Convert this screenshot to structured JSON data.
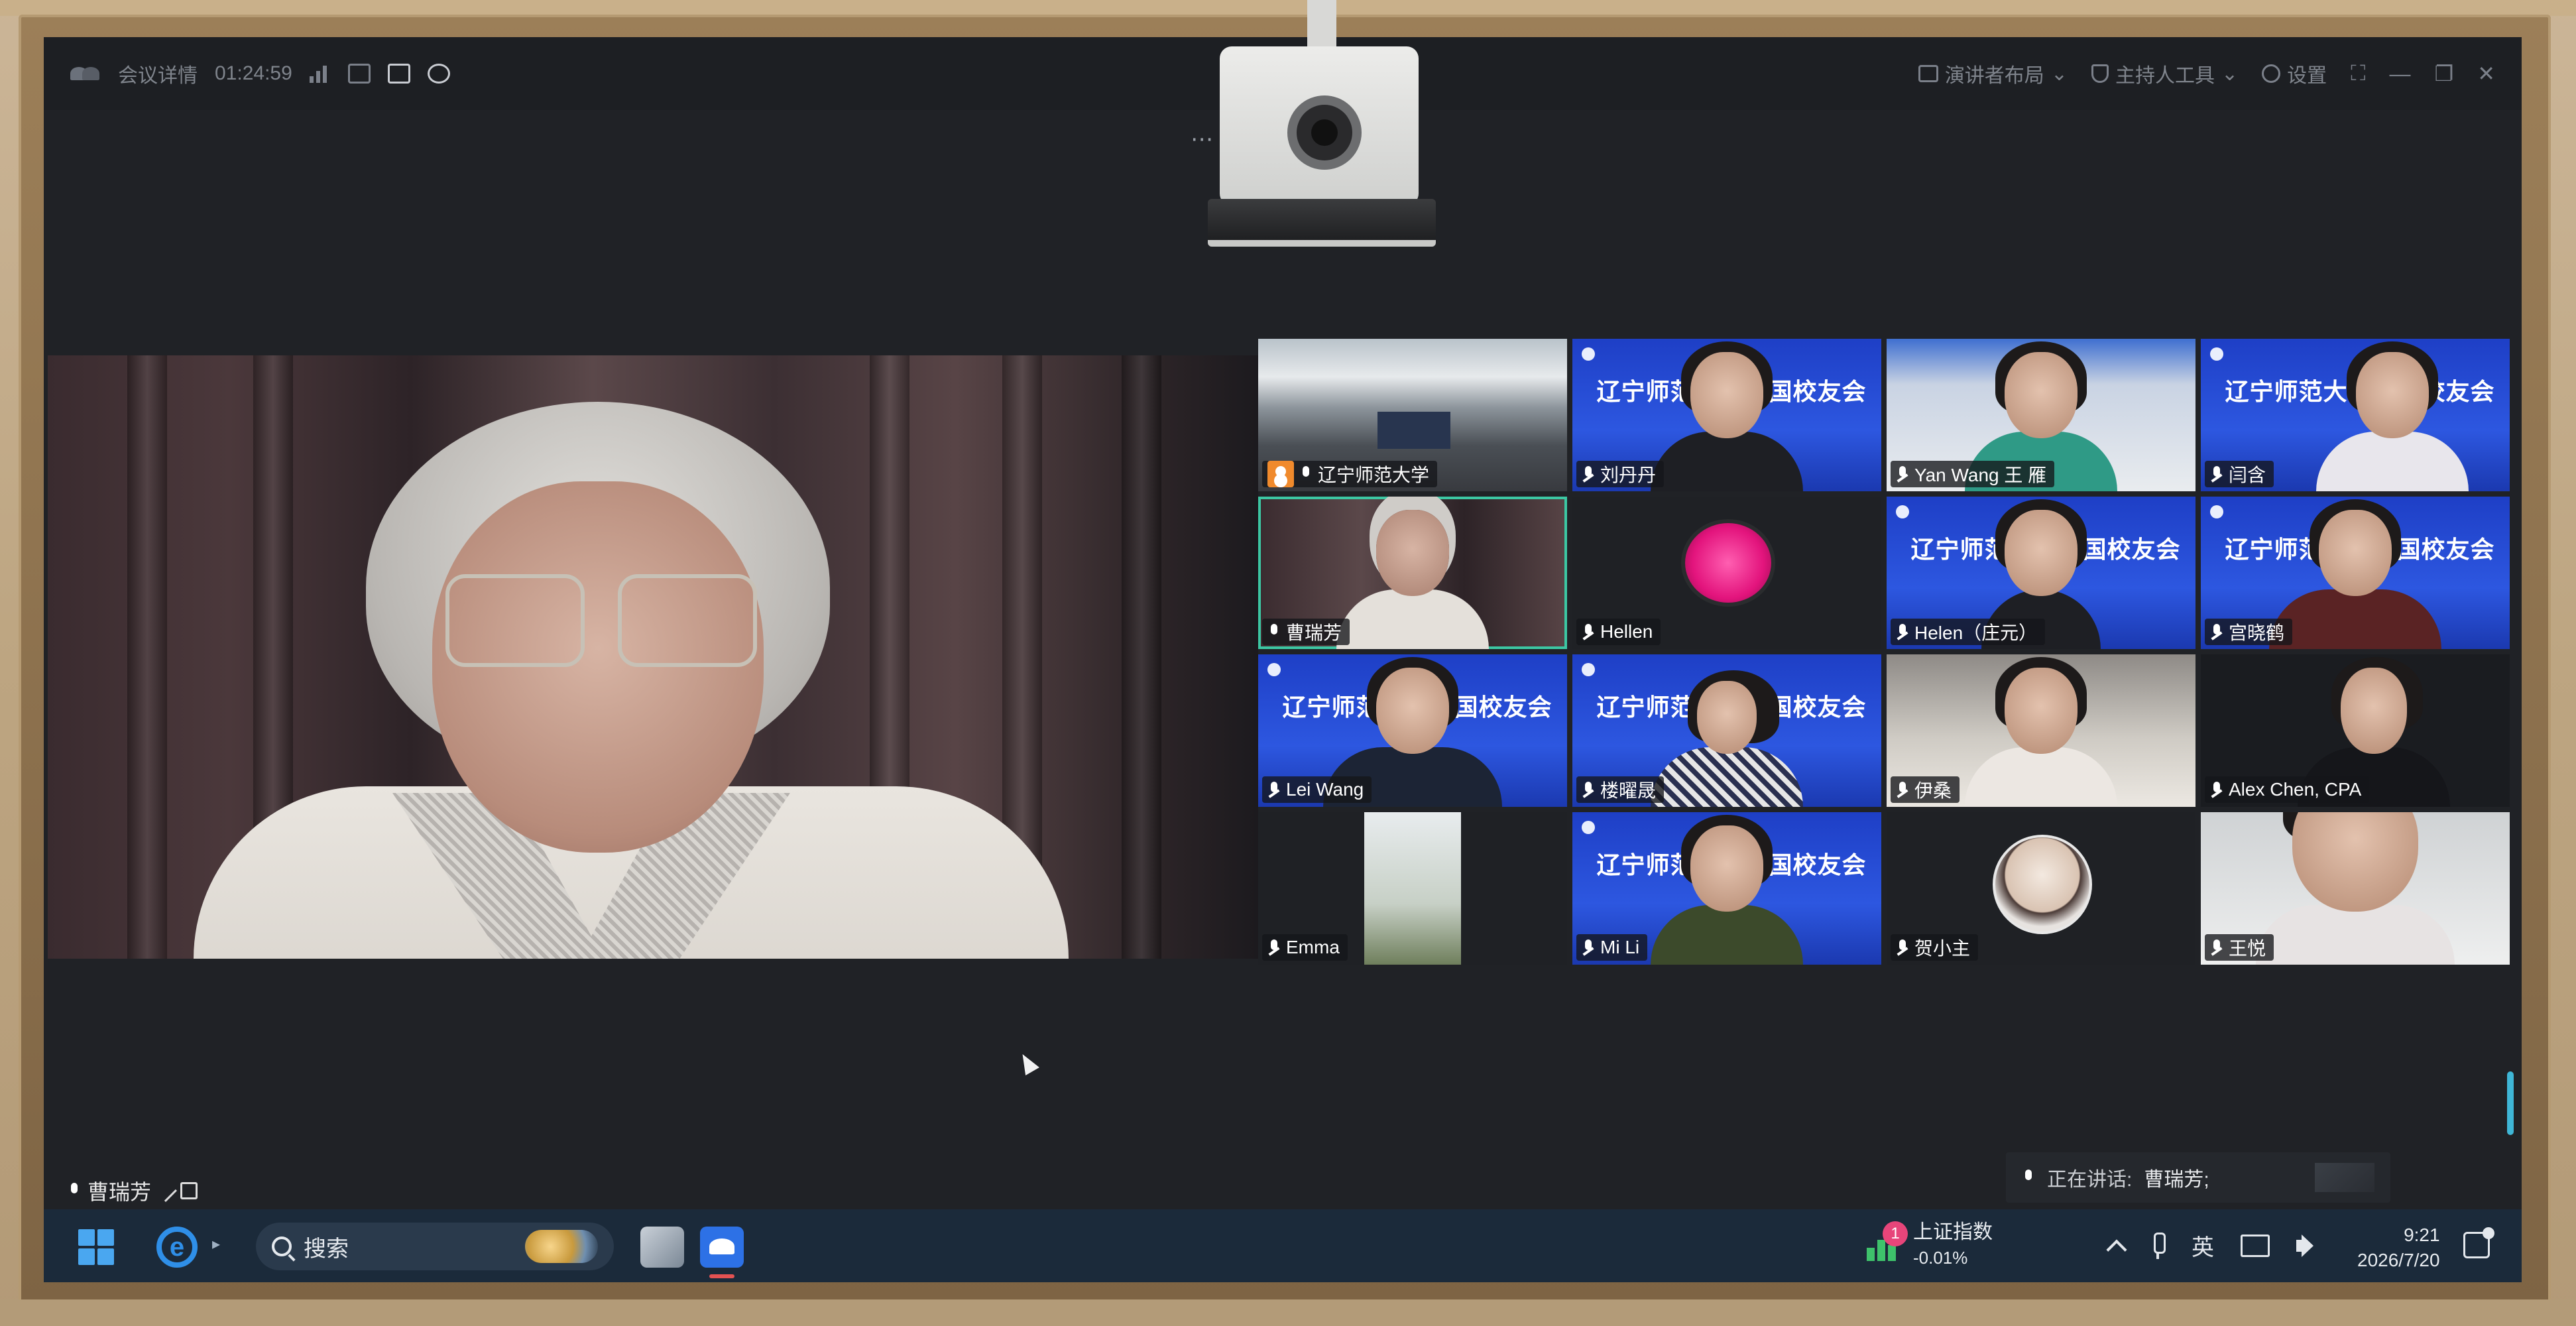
{
  "titlebar": {
    "meeting_info": "会议详情",
    "duration": "01:24:59",
    "layout": "演讲者布局",
    "host_tools": "主持人工具",
    "settings": "设置"
  },
  "main_speaker": {
    "name": "曹瑞芳"
  },
  "participants": [
    {
      "name": "辽宁师范大学",
      "banner": "",
      "host": true
    },
    {
      "name": "刘丹丹",
      "banner": "辽宁师范大学美国校友会"
    },
    {
      "name": "Yan Wang 王 雁",
      "banner": ""
    },
    {
      "name": "闫含",
      "banner": "辽宁师范大学美国校友会"
    },
    {
      "name": "曹瑞芳",
      "banner": "",
      "active": true
    },
    {
      "name": "Hellen",
      "banner": ""
    },
    {
      "name": "Helen（庄元）",
      "banner": "辽宁师范大学美国校友会"
    },
    {
      "name": "宫晓鹤",
      "banner": "辽宁师范大学美国校友会"
    },
    {
      "name": "Lei Wang",
      "banner": "辽宁师范大学美国校友会"
    },
    {
      "name": "楼曜晟",
      "banner": "辽宁师范大学美国校友会"
    },
    {
      "name": "伊桑",
      "banner": ""
    },
    {
      "name": "Alex Chen, CPA",
      "banner": ""
    },
    {
      "name": "Emma",
      "banner": ""
    },
    {
      "name": "Mi Li",
      "banner": "辽宁师范大学美国校友会"
    },
    {
      "name": "贺小主",
      "banner": ""
    },
    {
      "name": "王悦",
      "banner": ""
    }
  ],
  "speaking": {
    "label": "正在讲话:",
    "name": "曹瑞芳;"
  },
  "local_user": {
    "name": "曹瑞芳"
  },
  "taskbar": {
    "search_label": "搜索",
    "stock_name": "上证指数",
    "stock_change": "-0.01%",
    "stock_badge": "1",
    "ime": "英",
    "time": "9:21",
    "date": "2026/7/20"
  }
}
